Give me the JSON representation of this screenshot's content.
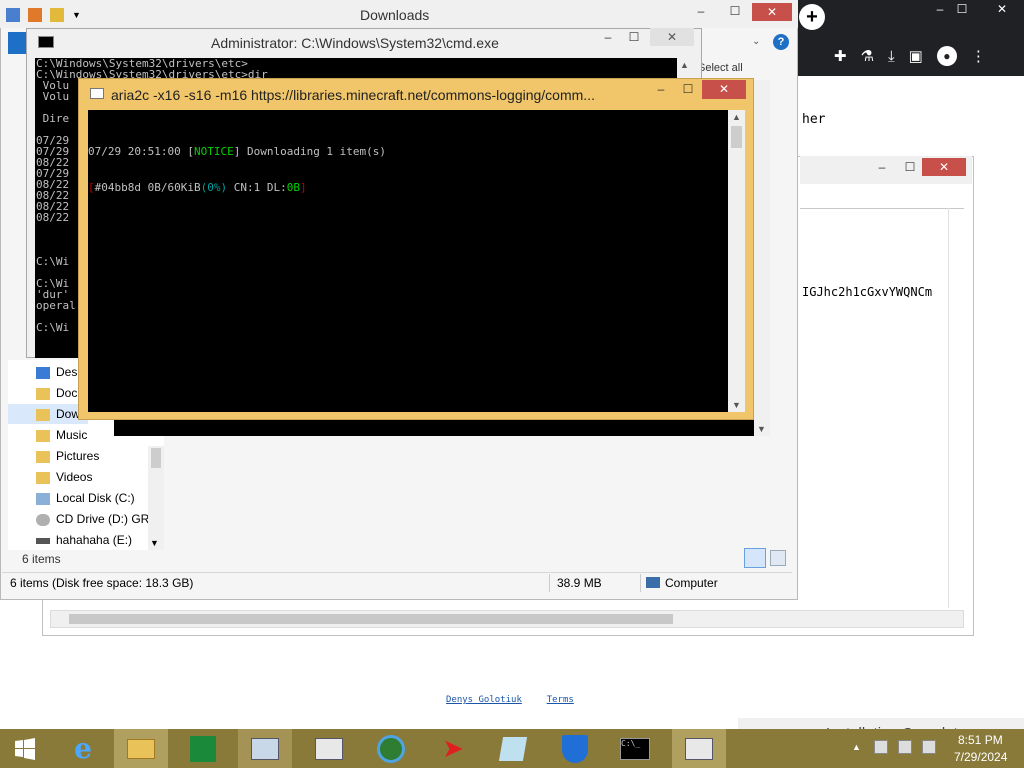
{
  "browser": {
    "tab_plus": "+",
    "page_text_right": "her",
    "encoded_text": "IGJhc2h1cGxvYWQNCm",
    "footer_link_author": "Denys Golotiuk",
    "footer_link_terms": "Terms",
    "notice": "Installation Complete"
  },
  "explorer": {
    "title": "Downloads",
    "select_all": "Select all",
    "tree_items": [
      {
        "label": "Des"
      },
      {
        "label": "Doc"
      },
      {
        "label": "Dow"
      },
      {
        "label": "Music"
      },
      {
        "label": "Pictures"
      },
      {
        "label": "Videos"
      },
      {
        "label": "Local Disk (C:)"
      },
      {
        "label": "CD Drive (D:) GRI"
      },
      {
        "label": "hahahaha (E:)"
      }
    ],
    "item_count": "6 items",
    "status_left": "6 items (Disk free space: 18.3 GB)",
    "status_size": "38.9 MB",
    "status_location": "Computer"
  },
  "cmd": {
    "title": "Administrator: C:\\Windows\\System32\\cmd.exe",
    "lines": [
      "C:\\Windows\\System32\\drivers\\etc>",
      "C:\\Windows\\System32\\drivers\\etc>dir",
      " Volu",
      " Volu",
      "",
      " Dire",
      "",
      "07/29",
      "07/29",
      "08/22",
      "07/29",
      "08/22",
      "08/22",
      "08/22",
      "08/22",
      "",
      "",
      "",
      "C:\\Wi",
      "",
      "C:\\Wi",
      "'dur'",
      "operal",
      "",
      "C:\\Wi"
    ]
  },
  "aria": {
    "title": "aria2c  -x16 -s16 -m16 https://libraries.minecraft.net/commons-logging/comm...",
    "line1_time": "07/29 20:51:00 ",
    "line1_open": "[",
    "line1_notice": "NOTICE",
    "line1_rest": "] Downloading 1 item(s)",
    "line2_open": "[",
    "line2_main": "#04bb8d 0B/60KiB",
    "line2_pct": "(0%)",
    "line2_cn": " CN:1 DL:",
    "line2_dl": "0B",
    "line2_close": "]",
    "colors": {
      "notice": "#00d000",
      "pct": "#00a0a0",
      "dl": "#00d000",
      "bracket": "#c00000"
    }
  },
  "taskbar": {
    "time": "8:51 PM",
    "date": "7/29/2024"
  },
  "window_controls": {
    "minimize": "–",
    "maximize": "☐",
    "close": "✕"
  }
}
